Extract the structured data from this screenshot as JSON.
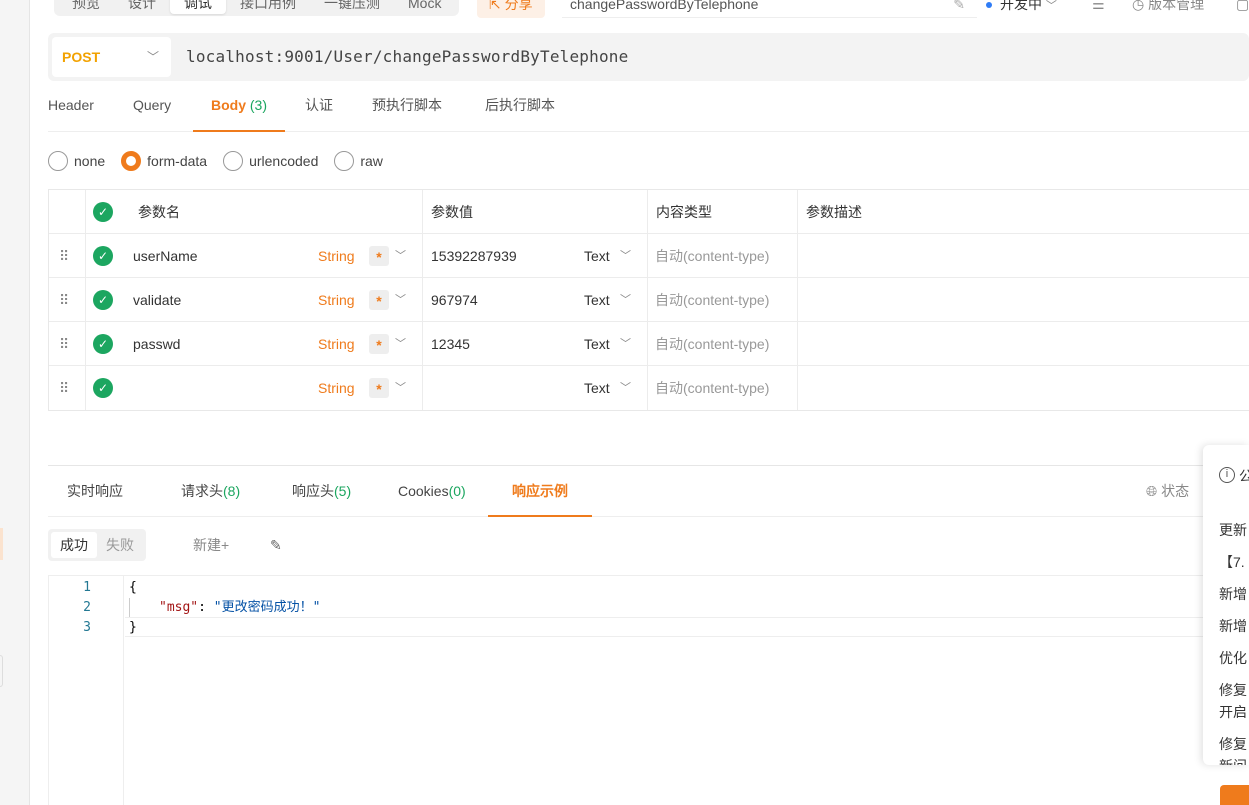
{
  "top": {
    "mode_tabs": [
      "预览",
      "设计",
      "调试",
      "接口用例",
      "一键压测",
      "Mock"
    ],
    "active_mode": "调试",
    "share_label": "分享",
    "api_title": "changePasswordByTelephone",
    "environment": "开发中",
    "version_label": "版本管理"
  },
  "request": {
    "method": "POST",
    "url": "localhost:9001/User/changePasswordByTelephone"
  },
  "req_tabs": {
    "header": "Header",
    "query": "Query",
    "body": "Body",
    "body_count": "(3)",
    "auth": "认证",
    "pre_script": "预执行脚本",
    "post_script": "后执行脚本"
  },
  "body_types": {
    "none": "none",
    "form_data": "form-data",
    "urlencoded": "urlencoded",
    "raw": "raw",
    "selected": "form-data"
  },
  "params_table": {
    "headers": {
      "name": "参数名",
      "value": "参数值",
      "content_type": "内容类型",
      "description": "参数描述"
    },
    "rows": [
      {
        "name": "userName",
        "type": "String",
        "required": "*",
        "value": "15392287939",
        "value_type": "Text",
        "content_type": "自动(content-type)",
        "description": ""
      },
      {
        "name": "validate",
        "type": "String",
        "required": "*",
        "value": "967974",
        "value_type": "Text",
        "content_type": "自动(content-type)",
        "description": ""
      },
      {
        "name": "passwd",
        "type": "String",
        "required": "*",
        "value": "12345",
        "value_type": "Text",
        "content_type": "自动(content-type)",
        "description": ""
      },
      {
        "name": "",
        "type": "String",
        "required": "*",
        "value": "",
        "value_type": "Text",
        "content_type": "自动(content-type)",
        "description": ""
      }
    ]
  },
  "resp_tabs": {
    "realtime": "实时响应",
    "req_headers": "请求头",
    "req_headers_count": "(8)",
    "resp_headers": "响应头",
    "resp_headers_count": "(5)",
    "cookies": "Cookies",
    "cookies_count": "(0)",
    "example": "响应示例",
    "status": "状态"
  },
  "example": {
    "success": "成功",
    "fail": "失败",
    "new": "新建",
    "plus": "+"
  },
  "code": {
    "line_numbers": [
      "1",
      "2",
      "3"
    ],
    "open": "{",
    "key": "\"msg\"",
    "colon": ": ",
    "value": "\"更改密码成功！\"",
    "close": "}"
  },
  "right_panel": {
    "title_partial": "公",
    "lines": [
      "更新",
      "【7.",
      "新增",
      "新增",
      "优化",
      "修复",
      "开启",
      "修复",
      "新问"
    ]
  }
}
